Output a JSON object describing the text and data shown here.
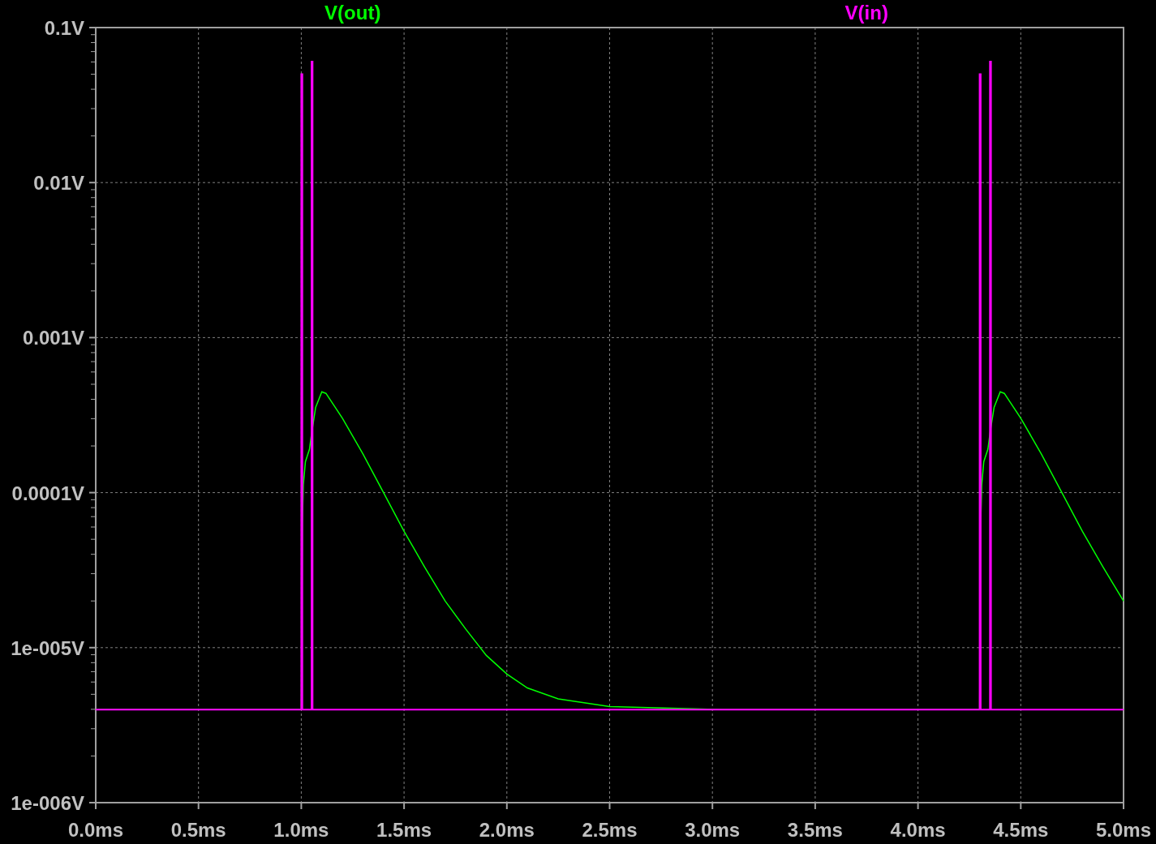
{
  "plot": {
    "traces": [
      {
        "name": "V(out)",
        "color": "#00ff00"
      },
      {
        "name": "V(in)",
        "color": "#ff00ff"
      }
    ],
    "x_axis_labels": [
      "0.0ms",
      "0.5ms",
      "1.0ms",
      "1.5ms",
      "2.0ms",
      "2.5ms",
      "3.0ms",
      "3.5ms",
      "4.0ms",
      "4.5ms",
      "5.0ms"
    ],
    "y_axis_labels": [
      "0.1V",
      "0.01V",
      "0.001V",
      "0.0001V",
      "1e-005V",
      "1e-006V"
    ]
  }
}
